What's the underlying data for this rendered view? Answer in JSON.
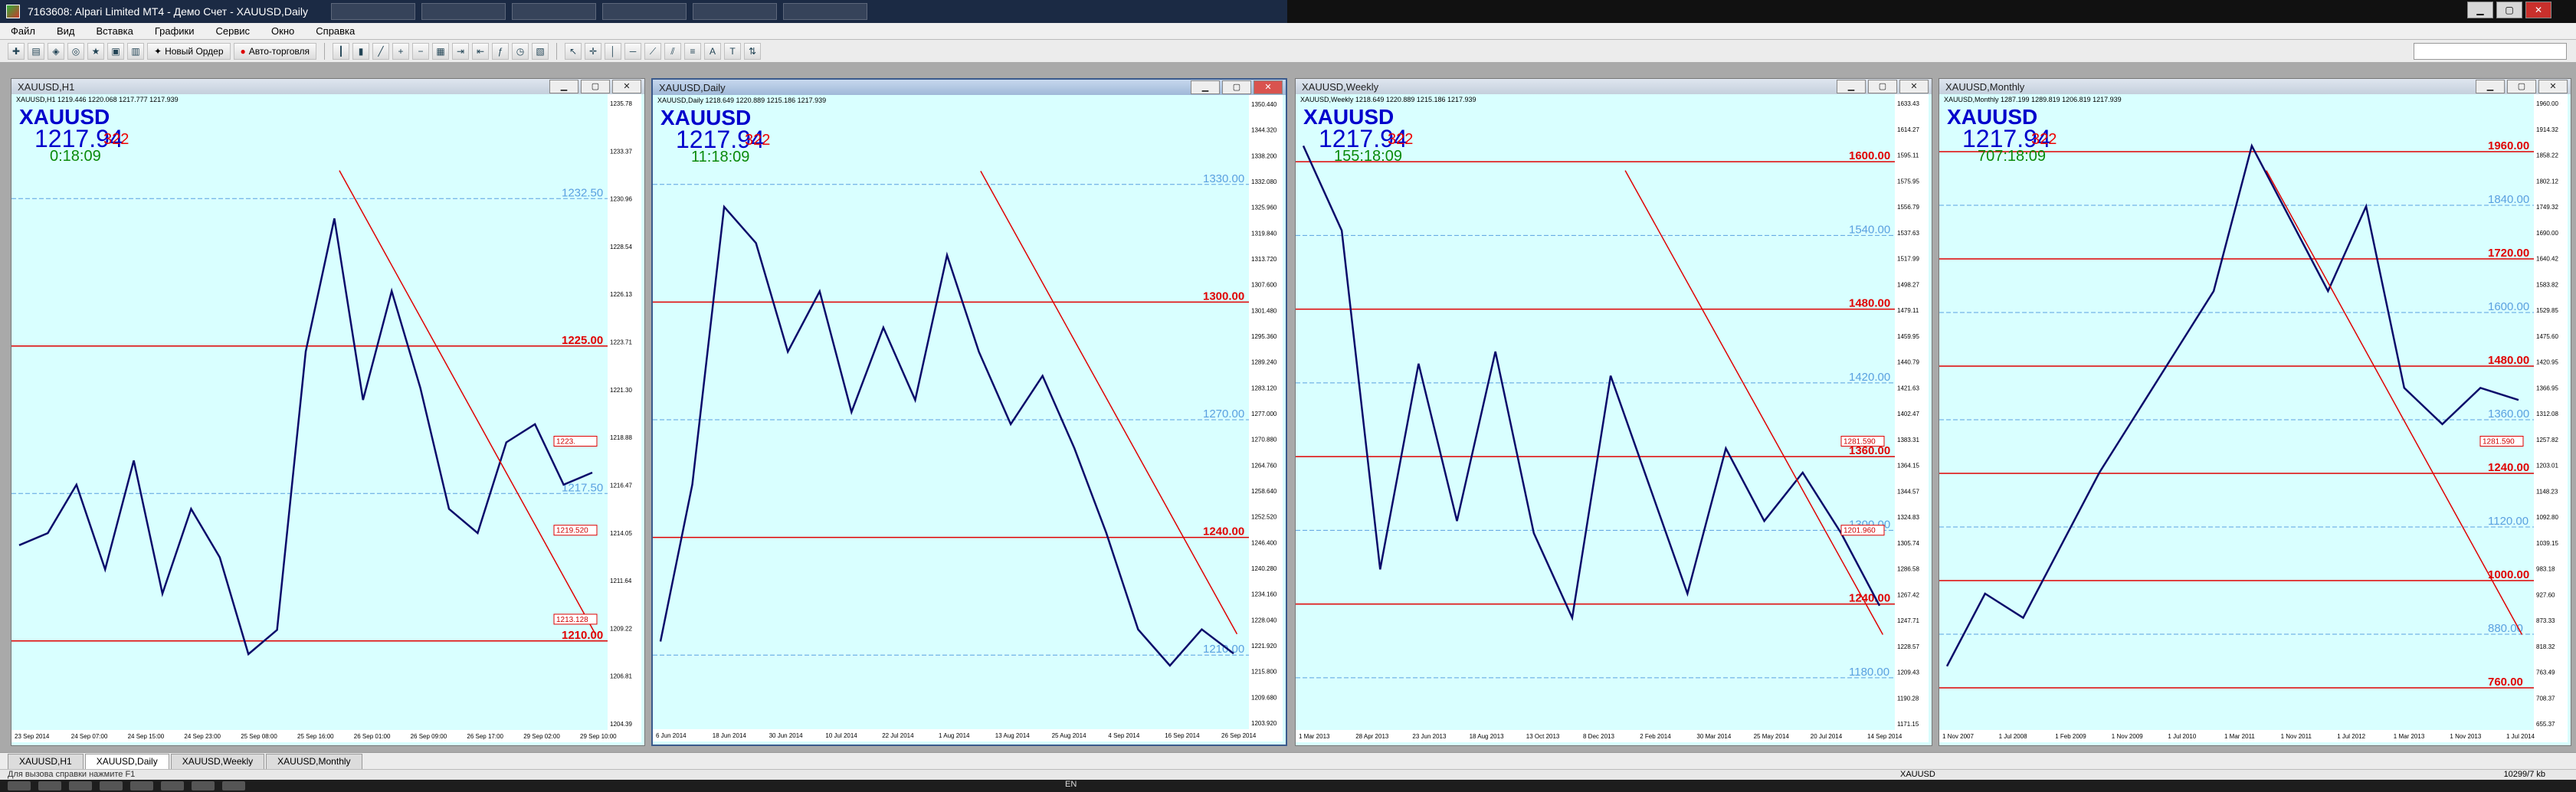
{
  "window": {
    "title": "7163608: Alpari Limited MT4 - Демо Счет - XAUUSD,Daily",
    "controls": {
      "min": "▁",
      "max": "▢",
      "close": "✕"
    }
  },
  "menu": [
    "Файл",
    "Вид",
    "Вставка",
    "Графики",
    "Сервис",
    "Окно",
    "Справка"
  ],
  "toolbar": {
    "new_order": "Новый Ордер",
    "auto_trading": "Авто-торговля"
  },
  "charts": [
    {
      "title": "XAUUSD,H1",
      "info": "XAUUSD,H1  1219.446 1220.068 1217.777 1217.939",
      "symbol": "XAUUSD",
      "price": "1217.94",
      "pips": "322",
      "timer": "0:18:09",
      "price_ticks": [
        "1235.78",
        "1233.37",
        "1230.96",
        "1228.54",
        "1226.13",
        "1223.71",
        "1221.30",
        "1218.88",
        "1216.47",
        "1214.05",
        "1211.64",
        "1209.22",
        "1206.81",
        "1204.39"
      ],
      "date_ticks": [
        "23 Sep 2014",
        "24 Sep 07:00",
        "24 Sep 15:00",
        "24 Sep 23:00",
        "25 Sep 08:00",
        "25 Sep 16:00",
        "26 Sep 01:00",
        "26 Sep 09:00",
        "26 Sep 17:00",
        "29 Sep 02:00",
        "29 Sep 10:00"
      ],
      "levels": [
        {
          "text": "1232.50",
          "color": "#5aa0e0"
        },
        {
          "text": "1225.00",
          "color": "#e00000"
        },
        {
          "text": "1217.50",
          "color": "#5aa0e0"
        },
        {
          "text": "1210.00",
          "color": "#e00000"
        }
      ],
      "boxes": [
        "1223.",
        "1219.520",
        "1213.128"
      ]
    },
    {
      "title": "XAUUSD,Daily",
      "info": "XAUUSD,Daily  1218.649 1220.889 1215.186 1217.939",
      "symbol": "XAUUSD",
      "price": "1217.94",
      "pips": "322",
      "timer": "11:18:09",
      "price_ticks": [
        "1350.440",
        "1344.320",
        "1338.200",
        "1332.080",
        "1325.960",
        "1319.840",
        "1313.720",
        "1307.600",
        "1301.480",
        "1295.360",
        "1289.240",
        "1283.120",
        "1277.000",
        "1270.880",
        "1264.760",
        "1258.640",
        "1252.520",
        "1246.400",
        "1240.280",
        "1234.160",
        "1228.040",
        "1221.920",
        "1215.800",
        "1209.680",
        "1203.920"
      ],
      "date_ticks": [
        "6 Jun 2014",
        "18 Jun 2014",
        "30 Jun 2014",
        "10 Jul 2014",
        "22 Jul 2014",
        "1 Aug 2014",
        "13 Aug 2014",
        "25 Aug 2014",
        "4 Sep 2014",
        "16 Sep 2014",
        "26 Sep 2014"
      ],
      "levels": [
        {
          "text": "1330.00",
          "color": "#5aa0e0"
        },
        {
          "text": "1300.00",
          "color": "#e00000"
        },
        {
          "text": "1270.00",
          "color": "#5aa0e0"
        },
        {
          "text": "1240.00",
          "color": "#e00000"
        },
        {
          "text": "1210.00",
          "color": "#5aa0e0"
        }
      ],
      "boxes": []
    },
    {
      "title": "XAUUSD,Weekly",
      "info": "XAUUSD,Weekly  1218.649 1220.889 1215.186 1217.939",
      "symbol": "XAUUSD",
      "price": "1217.94",
      "pips": "322",
      "timer": "155:18:09",
      "price_ticks": [
        "1633.43",
        "1614.27",
        "1595.11",
        "1575.95",
        "1556.79",
        "1537.63",
        "1517.99",
        "1498.27",
        "1479.11",
        "1459.95",
        "1440.79",
        "1421.63",
        "1402.47",
        "1383.31",
        "1364.15",
        "1344.57",
        "1324.83",
        "1305.74",
        "1286.58",
        "1267.42",
        "1247.71",
        "1228.57",
        "1209.43",
        "1190.28",
        "1171.15"
      ],
      "date_ticks": [
        "1 Mar 2013",
        "28 Apr 2013",
        "23 Jun 2013",
        "18 Aug 2013",
        "13 Oct 2013",
        "8 Dec 2013",
        "2 Feb 2014",
        "30 Mar 2014",
        "25 May 2014",
        "20 Jul 2014",
        "14 Sep 2014"
      ],
      "levels": [
        {
          "text": "1600.00",
          "color": "#e00000"
        },
        {
          "text": "1540.00",
          "color": "#5aa0e0"
        },
        {
          "text": "1480.00",
          "color": "#e00000"
        },
        {
          "text": "1420.00",
          "color": "#5aa0e0"
        },
        {
          "text": "1360.00",
          "color": "#e00000"
        },
        {
          "text": "1300.00",
          "color": "#5aa0e0"
        },
        {
          "text": "1240.00",
          "color": "#e00000"
        },
        {
          "text": "1180.00",
          "color": "#5aa0e0"
        }
      ],
      "boxes": [
        "1281.590",
        "1201.960"
      ]
    },
    {
      "title": "XAUUSD,Monthly",
      "info": "XAUUSD,Monthly  1287.199 1289.819 1206.819 1217.939",
      "symbol": "XAUUSD",
      "price": "1217.94",
      "pips": "322",
      "timer": "707:18:09",
      "price_ticks": [
        "1960.00",
        "1914.32",
        "1858.22",
        "1802.12",
        "1749.32",
        "1690.00",
        "1640.42",
        "1583.82",
        "1529.85",
        "1475.60",
        "1420.95",
        "1366.95",
        "1312.08",
        "1257.82",
        "1203.01",
        "1148.23",
        "1092.80",
        "1039.15",
        "983.18",
        "927.60",
        "873.33",
        "818.32",
        "763.49",
        "708.37",
        "655.37"
      ],
      "date_ticks": [
        "1 Nov 2007",
        "1 Jul 2008",
        "1 Feb 2009",
        "1 Nov 2009",
        "1 Jul 2010",
        "1 Mar 2011",
        "1 Nov 2011",
        "1 Jul 2012",
        "1 Mar 2013",
        "1 Nov 2013",
        "1 Jul 2014"
      ],
      "levels": [
        {
          "text": "1960.00",
          "color": "#e00000"
        },
        {
          "text": "1840.00",
          "color": "#5aa0e0"
        },
        {
          "text": "1720.00",
          "color": "#e00000"
        },
        {
          "text": "1600.00",
          "color": "#5aa0e0"
        },
        {
          "text": "1480.00",
          "color": "#e00000"
        },
        {
          "text": "1360.00",
          "color": "#5aa0e0"
        },
        {
          "text": "1240.00",
          "color": "#e00000"
        },
        {
          "text": "1120.00",
          "color": "#5aa0e0"
        },
        {
          "text": "1000.00",
          "color": "#e00000"
        },
        {
          "text": "880.00",
          "color": "#5aa0e0"
        },
        {
          "text": "760.00",
          "color": "#e00000"
        }
      ],
      "boxes": [
        "1281.590"
      ]
    }
  ],
  "tabs": [
    "XAUUSD,H1",
    "XAUUSD,Daily",
    "XAUUSD,Weekly",
    "XAUUSD,Monthly"
  ],
  "status": {
    "left": "Для вызова справки нажмите F1",
    "mid": "XAUUSD",
    "right": "10299/7 kb"
  },
  "taskbar": {
    "lang": "EN"
  }
}
